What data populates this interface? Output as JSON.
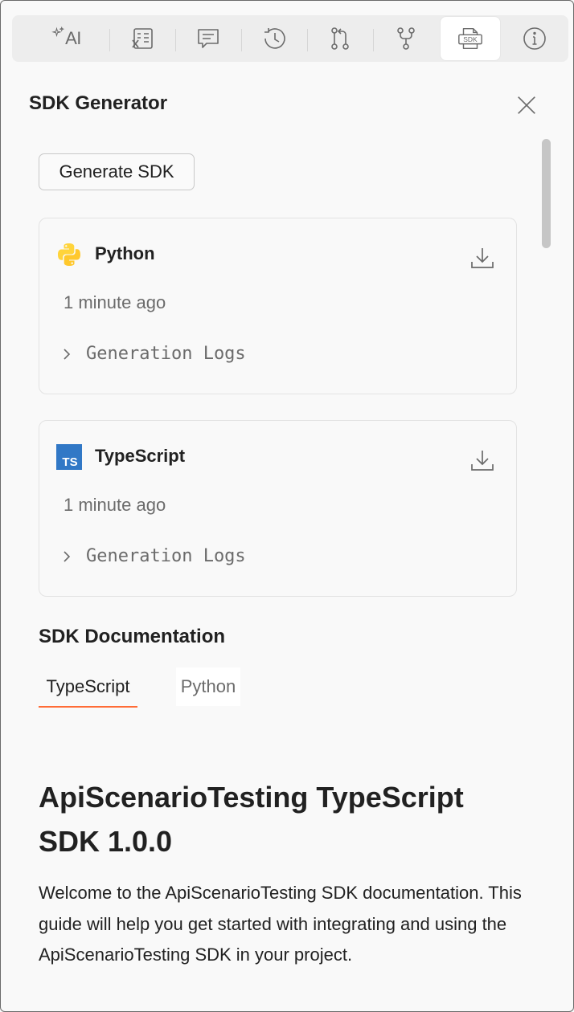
{
  "toolbar": {
    "ai_label": "AI",
    "sdk_badge": "SDK",
    "icons": [
      "ai-sparkle-icon",
      "variables-icon",
      "comments-icon",
      "history-icon",
      "pull-request-icon",
      "fork-icon",
      "sdk-icon",
      "info-icon"
    ]
  },
  "panel": {
    "title": "SDK Generator"
  },
  "generate_button": "Generate SDK",
  "sdks": [
    {
      "language": "Python",
      "time": "1 minute ago",
      "logs_label": "Generation Logs"
    },
    {
      "language": "TypeScript",
      "logo_text": "TS",
      "time": "1 minute ago",
      "logs_label": "Generation Logs"
    }
  ],
  "documentation": {
    "heading": "SDK Documentation",
    "tabs": [
      {
        "label": "TypeScript",
        "active": true
      },
      {
        "label": "Python",
        "active": false
      }
    ],
    "title": "ApiScenarioTesting TypeScript SDK 1.0.0",
    "body": "Welcome to the ApiScenarioTesting SDK documentation. This guide will help you get started with integrating and using the ApiScenarioTesting SDK in your project."
  },
  "colors": {
    "accent": "#ff6c37",
    "ts_blue": "#3178c6",
    "python_yellow": "#ffd43b"
  }
}
